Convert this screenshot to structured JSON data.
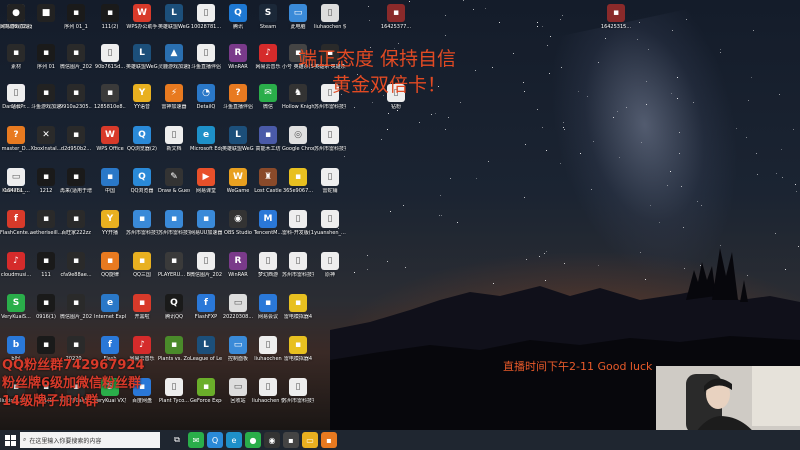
{
  "overlay": {
    "banner_line1": "端正态度 保持自信",
    "banner_line2": "黄金双倍卡！",
    "live_time": "直播时间下午2-11 Good luck",
    "fan_line1": "QQ粉丝群742967924",
    "fan_line2": "粉丝牌6级加微信粉丝群",
    "fan_line3": "14级牌子加小群"
  },
  "taskbar": {
    "search_placeholder": "在这里输入你要搜索的内容"
  },
  "icons": [
    {
      "label": "XTUBB-C2...",
      "color": "#7a7a7a",
      "glyph": "◉"
    },
    {
      "label": "",
      "color": "#222222",
      "glyph": "■"
    },
    {
      "label": "序列 01_1",
      "color": "#1a1a1a",
      "glyph": "▪"
    },
    {
      "label": "111(2)",
      "color": "#1a1a1a",
      "glyph": "▪"
    },
    {
      "label": "WPS办公助手",
      "color": "#d83a2a",
      "glyph": "W"
    },
    {
      "label": "英雄联盟WeGame版",
      "color": "#1c4f7a",
      "glyph": "L"
    },
    {
      "label": "10028781...",
      "color": "#eeeeee",
      "glyph": "▯"
    },
    {
      "label": "腾讯",
      "color": "#1e78d2",
      "glyph": "Q"
    },
    {
      "label": "Steam",
      "color": "#1b2838",
      "glyph": "S"
    },
    {
      "label": "此电脑",
      "color": "#3a8ad8",
      "glyph": "▭"
    },
    {
      "label": "liuhaochen 快捷方式(2)",
      "color": "#dddddd",
      "glyph": "▯"
    },
    {
      "label": "网易游戏加速器",
      "color": "#222222",
      "glyph": "●"
    },
    {
      "label": "素材",
      "color": "#2a2a2a",
      "glyph": "▪"
    },
    {
      "label": "序列 01",
      "color": "#1a1a1a",
      "glyph": "▪"
    },
    {
      "label": "微信图片_2021102...",
      "color": "#2a2a2a",
      "glyph": "▪"
    },
    {
      "label": "90b7615d...",
      "color": "#eeeeee",
      "glyph": "▯"
    },
    {
      "label": "英雄联盟WeGame版",
      "color": "#1c4f7a",
      "glyph": "L"
    },
    {
      "label": "灵鹿游戏加速器",
      "color": "#2a6fb0",
      "glyph": "▲"
    },
    {
      "label": "斗鱼直播伴侣",
      "color": "#eeeeee",
      "glyph": "▯"
    },
    {
      "label": "WinRAR",
      "color": "#7a3a8a",
      "glyph": "R"
    },
    {
      "label": "网易云音乐",
      "color": "#d52b2b",
      "glyph": "♪"
    },
    {
      "label": "小号 英雄杀(Skol Th...",
      "color": "#444444",
      "glyph": "▪"
    },
    {
      "label": "英雄杀 英雄杀",
      "color": "#2a2a2a",
      "glyph": "▪"
    },
    {
      "label": "DanmuPr...",
      "color": "#7a3a8a",
      "glyph": "R"
    },
    {
      "label": "斗鱼游戏加速",
      "color": "#222222",
      "glyph": "▪"
    },
    {
      "label": "9910a2305...",
      "color": "#2a2a2a",
      "glyph": "▪"
    },
    {
      "label": "1285810e8...",
      "color": "#3a3a3a",
      "glyph": "▪"
    },
    {
      "label": "YY语音",
      "color": "#e8b020",
      "glyph": "Y"
    },
    {
      "label": "雷神加速器",
      "color": "#e87a20",
      "glyph": "⚡"
    },
    {
      "label": "DetailQ",
      "color": "#2a78c8",
      "glyph": "◔"
    },
    {
      "label": "斗鱼直播伴侣",
      "color": "#e87a20",
      "glyph": "?"
    },
    {
      "label": "微信",
      "color": "#2aae4a",
      "glyph": "✉"
    },
    {
      "label": "Hollow Knight",
      "color": "#333333",
      "glyph": "♞"
    },
    {
      "label": "苏州市雷科技实验",
      "color": "#eeeeee",
      "glyph": "▯"
    },
    {
      "label": "站长",
      "color": "#eeeeee",
      "glyph": "▯"
    },
    {
      "label": "master_D...",
      "color": "#e87a20",
      "glyph": "?"
    },
    {
      "label": "XboxInstal...",
      "color": "#2a2a2a",
      "glyph": "✕"
    },
    {
      "label": "d2d950b2...",
      "color": "#2a2a2a",
      "glyph": "▪"
    },
    {
      "label": "WPS Office",
      "color": "#d83a2a",
      "glyph": "W"
    },
    {
      "label": "QQ浏览器(2)",
      "color": "#2a8ad8",
      "glyph": "Q"
    },
    {
      "label": "新文档",
      "color": "#eeeeee",
      "glyph": "▯"
    },
    {
      "label": "Microsoft Edge",
      "color": "#1e90c8",
      "glyph": "e"
    },
    {
      "label": "英雄联盟WeGame版",
      "color": "#1c4f7a",
      "glyph": "L"
    },
    {
      "label": "高能木工坊",
      "color": "#4a5aa8",
      "glyph": "▪"
    },
    {
      "label": "Google Chrome",
      "color": "#e0e0e0",
      "glyph": "◎"
    },
    {
      "label": "苏州市雷科技实验",
      "color": "#eeeeee",
      "glyph": "▯"
    },
    {
      "label": "KaiHeLa_...",
      "color": "#2a78d8",
      "glyph": "☺"
    },
    {
      "label": "1212",
      "color": "#1a1a1a",
      "glyph": "▪"
    },
    {
      "label": "再来(适用于增强...",
      "color": "#1a1a1a",
      "glyph": "▪"
    },
    {
      "label": "中国",
      "color": "#2a78c8",
      "glyph": "▪"
    },
    {
      "label": "QQ浏览器",
      "color": "#2a8ad8",
      "glyph": "Q"
    },
    {
      "label": "Draw & Guess",
      "color": "#333333",
      "glyph": "✎"
    },
    {
      "label": "网易课堂",
      "color": "#e8502a",
      "glyph": "▶"
    },
    {
      "label": "WeGame",
      "color": "#e8a020",
      "glyph": "W"
    },
    {
      "label": "Lost Castle",
      "color": "#8a4a2a",
      "glyph": "♜"
    },
    {
      "label": "365e9067...",
      "color": "#e8c020",
      "glyph": "▪"
    },
    {
      "label": "雷蛇铺",
      "color": "#eeeeee",
      "glyph": "▯"
    },
    {
      "label": "164781...",
      "color": "#eeeeee",
      "glyph": "▭"
    },
    {
      "label": "FlashCente...",
      "color": "#d83a2a",
      "glyph": "f"
    },
    {
      "label": "aetheriseill...",
      "color": "#2a2a2a",
      "glyph": "▪"
    },
    {
      "label": "百旺家222zz",
      "color": "#2a2a2a",
      "glyph": "▪"
    },
    {
      "label": "YY开播",
      "color": "#e8b020",
      "glyph": "Y"
    },
    {
      "label": "苏州市雷科技实验",
      "color": "#3a8ad8",
      "glyph": "▪"
    },
    {
      "label": "苏州市雷科技实验",
      "color": "#3a8ad8",
      "glyph": "▪"
    },
    {
      "label": "网易UU加速器",
      "color": "#3a8ad8",
      "glyph": "▪"
    },
    {
      "label": "OBS Studio",
      "color": "#333333",
      "glyph": "◉"
    },
    {
      "label": "TencentM...",
      "color": "#2a78d8",
      "glyph": "M"
    },
    {
      "label": "雷科-开发版(1)",
      "color": "#eeeeee",
      "glyph": "▯"
    },
    {
      "label": "yuanshen_...",
      "color": "#eeeeee",
      "glyph": "▯"
    },
    {
      "label": "cloudmusi...",
      "color": "#d52b2b",
      "glyph": "♪"
    },
    {
      "label": "111",
      "color": "#1a1a1a",
      "glyph": "▪"
    },
    {
      "label": "cfa9e88ae...",
      "color": "#2a2a2a",
      "glyph": "▪"
    },
    {
      "label": "QQ旋律",
      "color": "#e87a20",
      "glyph": "▪"
    },
    {
      "label": "QQ三国",
      "color": "#e8b020",
      "glyph": "▪"
    },
    {
      "label": "PLAYERU... BATTLEGR...",
      "color": "#3a3a3a",
      "glyph": "▪"
    },
    {
      "label": "微信图片_2022011...",
      "color": "#eeeeee",
      "glyph": "▯"
    },
    {
      "label": "WinRAR",
      "color": "#7a3a8a",
      "glyph": "R"
    },
    {
      "label": "梦幻西游",
      "color": "#eeeeee",
      "glyph": "▯"
    },
    {
      "label": "苏州市雷科技实验",
      "color": "#eeeeee",
      "glyph": "▯"
    },
    {
      "label": "原神",
      "color": "#eeeeee",
      "glyph": "▯"
    },
    {
      "label": "VeryKuaiS...",
      "color": "#2aae4a",
      "glyph": "S"
    },
    {
      "label": "0916(1)",
      "color": "#1a1a1a",
      "glyph": "▪"
    },
    {
      "label": "微信图片_2021111...",
      "color": "#2a2a2a",
      "glyph": "▪"
    },
    {
      "label": "Internet Explorer",
      "color": "#2a78c8",
      "glyph": "e"
    },
    {
      "label": "开黑啦",
      "color": "#d83a2a",
      "glyph": "▪"
    },
    {
      "label": "腾讯QQ",
      "color": "#1a1a1a",
      "glyph": "Q"
    },
    {
      "label": "FlashFXP",
      "color": "#2a78d8",
      "glyph": "f"
    },
    {
      "label": "20220308...",
      "color": "#dddddd",
      "glyph": "▭"
    },
    {
      "label": "网易会议",
      "color": "#2a78d8",
      "glyph": "▪"
    },
    {
      "label": "雷电模拟器4",
      "color": "#e8c020",
      "glyph": "▪"
    },
    {
      "label": "blbl",
      "color": "#2a78d8",
      "glyph": "b"
    },
    {
      "label": "",
      "color": "#1a1a1a",
      "glyph": "▪"
    },
    {
      "label": "20220...",
      "color": "#2a2a2a",
      "glyph": "▪"
    },
    {
      "label": "Flash",
      "color": "#2a78d8",
      "glyph": "f"
    },
    {
      "label": "网易云音乐",
      "color": "#d52b2b",
      "glyph": "♪"
    },
    {
      "label": "Plants vs. Zombies G...",
      "color": "#4a8a2a",
      "glyph": "▪"
    },
    {
      "label": "League of Legends",
      "color": "#1c4f7a",
      "glyph": "L"
    },
    {
      "label": "控制面板",
      "color": "#3a8ad8",
      "glyph": "▭"
    },
    {
      "label": "liuhaochen",
      "color": "#eeeeee",
      "glyph": "▯"
    },
    {
      "label": "雷电模拟器4",
      "color": "#e8c020",
      "glyph": "▪"
    },
    {
      "label": "liuxing_1.6...",
      "color": "#2a2a2a",
      "glyph": "▪"
    },
    {
      "label": "111(1)",
      "color": "#1a1a1a",
      "glyph": "▪"
    },
    {
      "label": "6c2780ae5...",
      "color": "#2a2a2a",
      "glyph": "▪"
    },
    {
      "label": "VeryKuai VX加速器",
      "color": "#2aae4a",
      "glyph": "S"
    },
    {
      "label": "百度网盘",
      "color": "#2a78d8",
      "glyph": "▪"
    },
    {
      "label": "Plant Tyco...",
      "color": "#eeeeee",
      "glyph": "▯"
    },
    {
      "label": "GeForce Experience",
      "color": "#6aae2a",
      "glyph": "▪"
    },
    {
      "label": "回收站",
      "color": "#dddddd",
      "glyph": "▭"
    },
    {
      "label": "liuhaochen 快捷方式",
      "color": "#eeeeee",
      "glyph": "▯"
    },
    {
      "label": "苏州市雷科技实验",
      "color": "#eeeeee",
      "glyph": "▯"
    },
    {
      "label": "16425377...",
      "color": "#8a2a2a",
      "glyph": "▪"
    },
    {
      "label": "16425315...",
      "color": "#8a2a2a",
      "glyph": "▪"
    },
    {
      "label": "钻粉",
      "color": "#eeeeee",
      "glyph": "▯"
    }
  ],
  "taskbar_apps": [
    {
      "name": "task-view-icon",
      "color": "#1f2630",
      "glyph": "⧉"
    },
    {
      "name": "wechat-icon",
      "color": "#2aae4a",
      "glyph": "✉"
    },
    {
      "name": "qq-browser-icon",
      "color": "#2a8ad8",
      "glyph": "Q"
    },
    {
      "name": "edge-icon",
      "color": "#1e90c8",
      "glyph": "e"
    },
    {
      "name": "chat-icon",
      "color": "#2aae4a",
      "glyph": "●"
    },
    {
      "name": "obs-icon",
      "color": "#333333",
      "glyph": "◉"
    },
    {
      "name": "app-icon",
      "color": "#444444",
      "glyph": "▪"
    },
    {
      "name": "folder-icon",
      "color": "#e8b020",
      "glyph": "▭"
    },
    {
      "name": "media-icon",
      "color": "#e87a20",
      "glyph": "▪"
    }
  ]
}
